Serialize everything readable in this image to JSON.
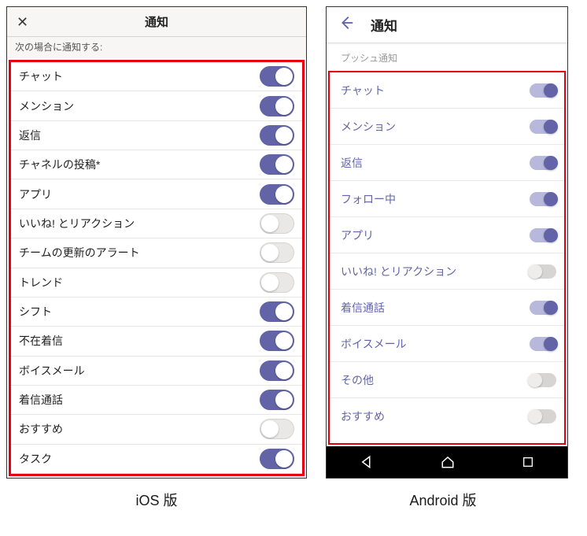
{
  "ios": {
    "header_title": "通知",
    "subheader": "次の場合に通知する:",
    "items": [
      {
        "label": "チャット",
        "on": true
      },
      {
        "label": "メンション",
        "on": true
      },
      {
        "label": "返信",
        "on": true
      },
      {
        "label": "チャネルの投稿*",
        "on": true
      },
      {
        "label": "アプリ",
        "on": true
      },
      {
        "label": "いいね! とリアクション",
        "on": false
      },
      {
        "label": "チームの更新のアラート",
        "on": false
      },
      {
        "label": "トレンド",
        "on": false
      },
      {
        "label": "シフト",
        "on": true
      },
      {
        "label": "不在着信",
        "on": true
      },
      {
        "label": "ボイスメール",
        "on": true
      },
      {
        "label": "着信通話",
        "on": true
      },
      {
        "label": "おすすめ",
        "on": false
      },
      {
        "label": "タスク",
        "on": true
      }
    ],
    "caption": "iOS 版"
  },
  "android": {
    "header_title": "通知",
    "subheader": "プッシュ通知",
    "items": [
      {
        "label": "チャット",
        "on": true
      },
      {
        "label": "メンション",
        "on": true
      },
      {
        "label": "返信",
        "on": true
      },
      {
        "label": "フォロー中",
        "on": true
      },
      {
        "label": "アプリ",
        "on": true
      },
      {
        "label": "いいね! とリアクション",
        "on": false
      },
      {
        "label": "着信通話",
        "on": true
      },
      {
        "label": "ボイスメール",
        "on": true
      },
      {
        "label": "その他",
        "on": false
      },
      {
        "label": "おすすめ",
        "on": false
      }
    ],
    "caption": "Android 版"
  },
  "accent": "#6264a7",
  "highlight": "#e60012"
}
